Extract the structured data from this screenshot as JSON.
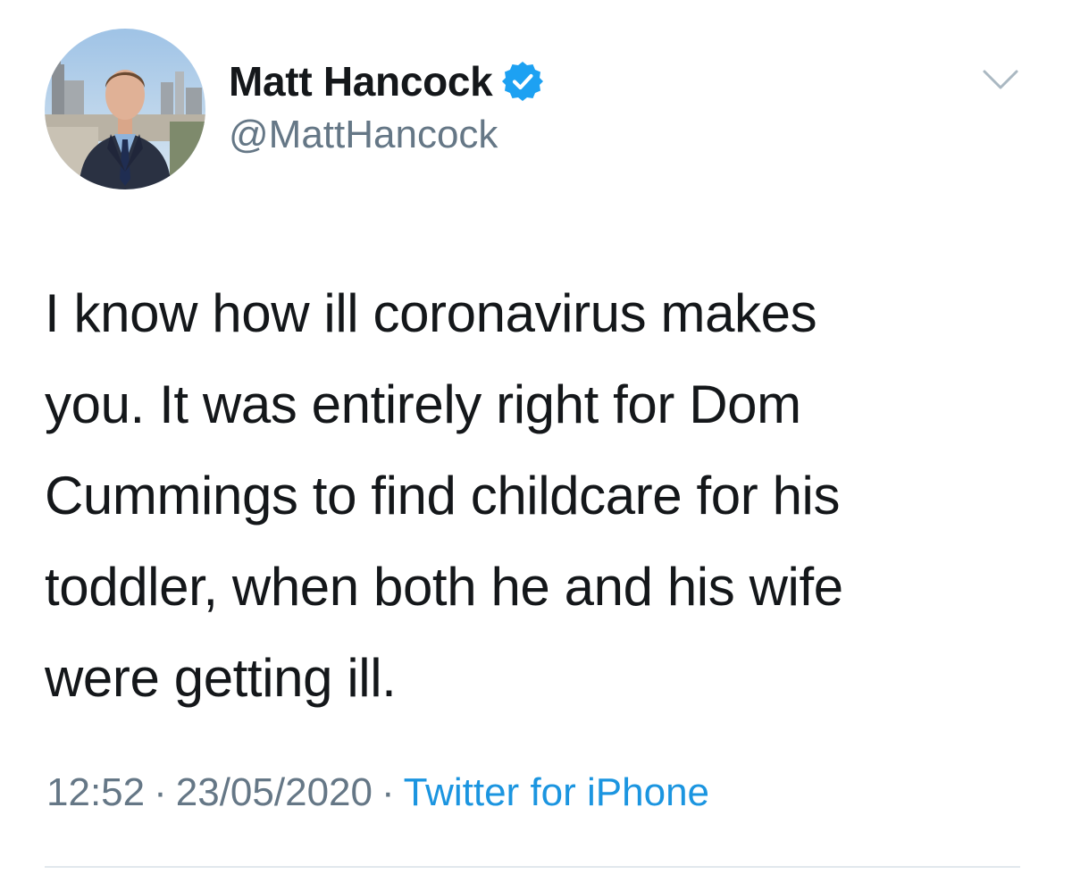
{
  "user": {
    "display_name": "Matt Hancock",
    "handle": "@MattHancock",
    "verified": true,
    "verified_icon": "verified-badge-icon",
    "avatar_icon": "profile-photo",
    "menu_icon": "chevron-down-icon"
  },
  "tweet": {
    "lines": [
      "I know how ill coronavirus makes",
      "you. It was entirely right for Dom",
      "Cummings to find childcare for his",
      "toddler, when both he and his wife",
      "were getting ill."
    ],
    "time": "12:52",
    "date": "23/05/2020",
    "separator": "·",
    "source": "Twitter for iPhone"
  },
  "colors": {
    "text": "#14171a",
    "secondary": "#657786",
    "link": "#1b95e0",
    "verified": "#1da1f2",
    "divider": "#e1e8ed"
  }
}
